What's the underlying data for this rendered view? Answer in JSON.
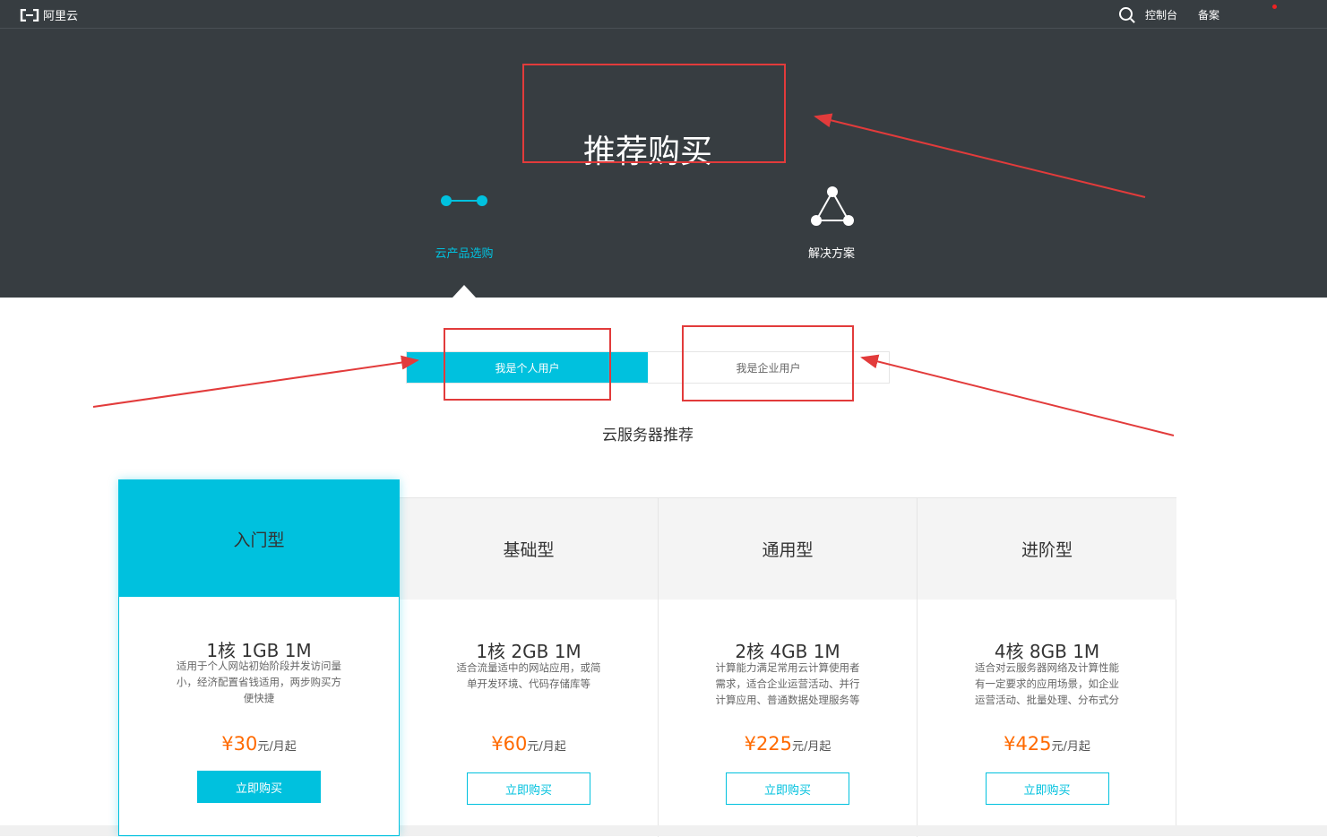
{
  "topbar": {
    "logo_text": "阿里云",
    "console_label": "控制台",
    "record_label": "备案"
  },
  "hero": {
    "title": "推荐购买",
    "tabs": [
      {
        "label": "云产品选购",
        "icon": "connected-dots-icon",
        "active": true
      },
      {
        "label": "解决方案",
        "icon": "triangle-network-icon",
        "active": false
      }
    ]
  },
  "user_switch": {
    "personal_label": "我是个人用户",
    "enterprise_label": "我是企业用户"
  },
  "section_title": "云服务器推荐",
  "plans": [
    {
      "name": "入门型",
      "spec": "1核 1GB 1M",
      "desc": "适用于个人网站初始阶段并发访问量小，经济配置省钱适用，两步购买方便快捷",
      "price": "¥30",
      "unit": "元/月起",
      "button": "立即购买"
    },
    {
      "name": "基础型",
      "spec": "1核 2GB 1M",
      "desc": "适合流量适中的网站应用，或简单开发环境、代码存储库等",
      "price": "¥60",
      "unit": "元/月起",
      "button": "立即购买"
    },
    {
      "name": "通用型",
      "spec": "2核 4GB 1M",
      "desc": "计算能力满足常用云计算使用者需求，适合企业运营活动、并行计算应用、普通数据处理服务等",
      "price": "¥225",
      "unit": "元/月起",
      "button": "立即购买"
    },
    {
      "name": "进阶型",
      "spec": "4核 8GB 1M",
      "desc": "适合对云服务器网络及计算性能有一定要求的应用场景，如企业运营活动、批量处理、分布式分析、简",
      "price": "¥425",
      "unit": "元/月起",
      "button": "立即购买"
    }
  ],
  "colors": {
    "accent": "#00c1de",
    "dark_bg": "#373d41",
    "price": "#ff6a00",
    "annotation": "#e23b3b"
  }
}
